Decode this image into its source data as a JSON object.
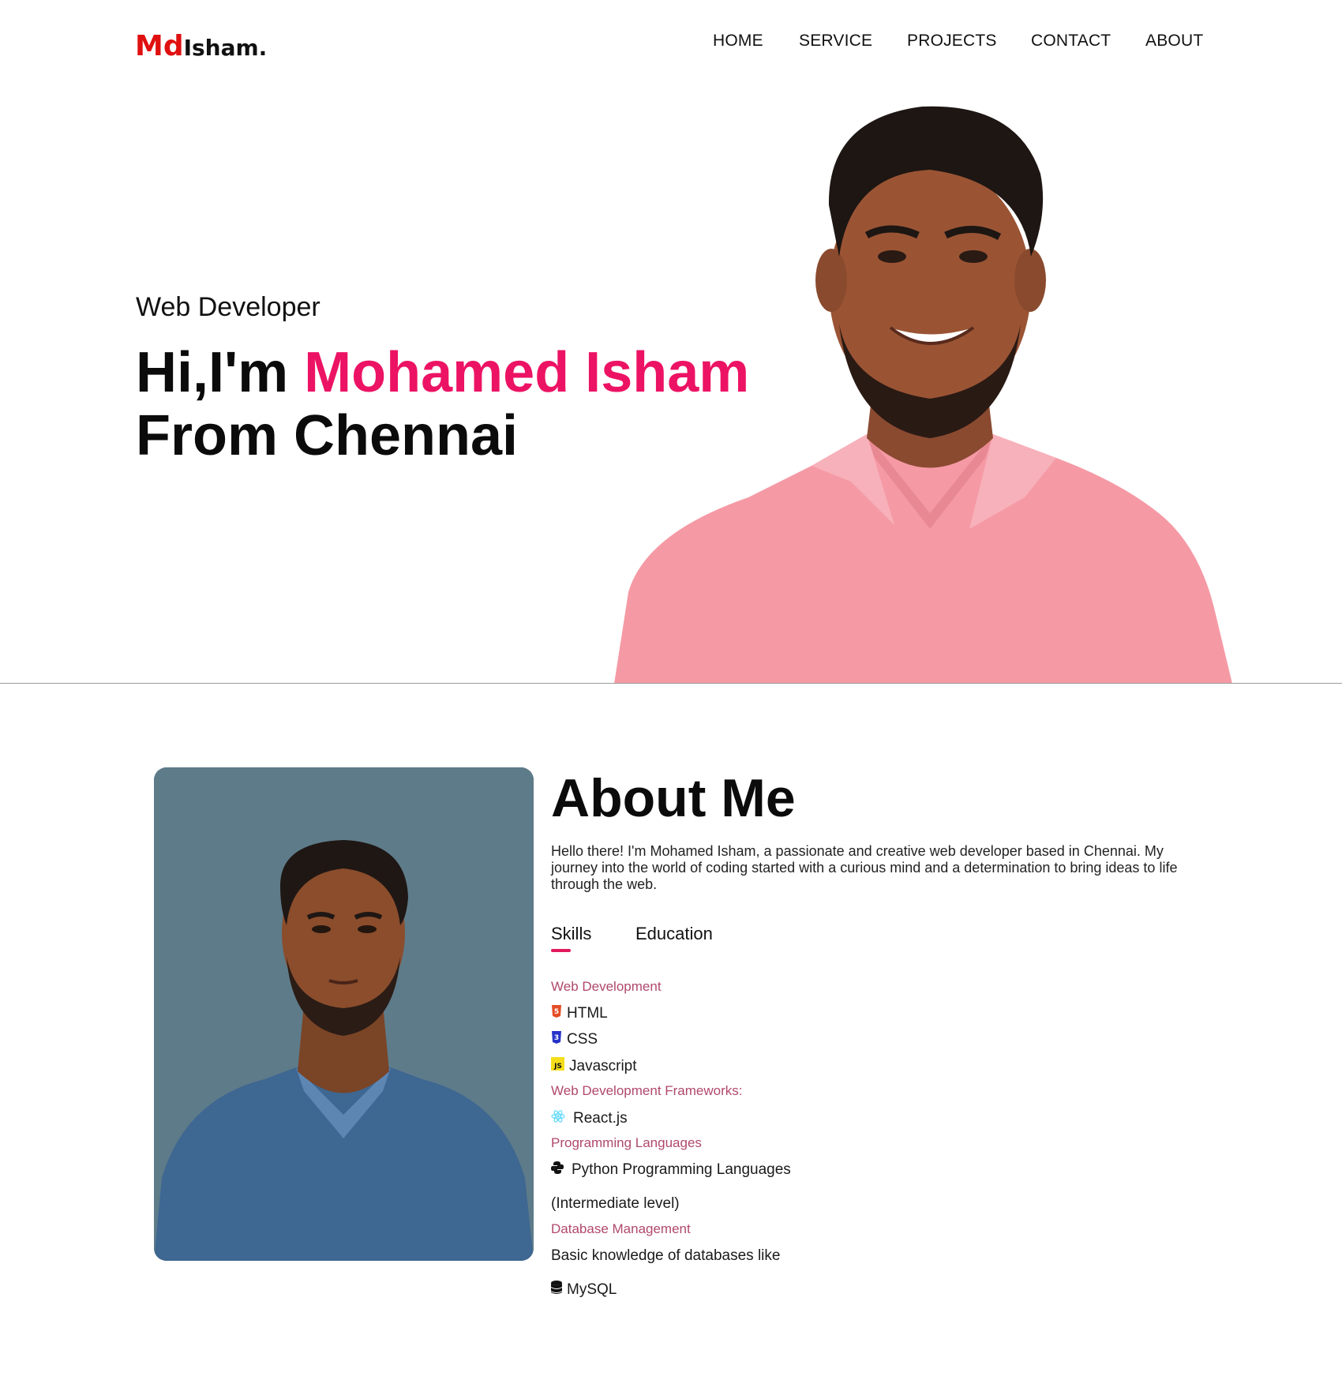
{
  "logo": {
    "md": "Md",
    "rest": "Isham."
  },
  "nav": {
    "home": "HOME",
    "service": "SERVICE",
    "projects": "PROJECTS",
    "contact": "CONTACT",
    "about": "ABOUT"
  },
  "hero": {
    "role": "Web Developer",
    "greeting": "Hi,I'm ",
    "name": "Mohamed Isham",
    "line2": "From Chennai"
  },
  "about": {
    "title": "About Me",
    "text": "Hello there! I'm Mohamed Isham, a passionate and creative web developer based in Chennai. My journey into the world of coding started with a curious mind and a determination to bring ideas to life through the web.",
    "tabs": {
      "skills": "Skills",
      "education": "Education"
    },
    "skills": {
      "web_dev_title": "Web Development",
      "html": "HTML",
      "css": "CSS",
      "js": "Javascript",
      "frameworks_title": "Web Development Frameworks:",
      "react": "React.js",
      "languages_title": "Programming Languages",
      "python": "Python Programming Languages",
      "python_level": "(Intermediate level)",
      "db_title": "Database Management",
      "db_text": "Basic knowledge of databases like",
      "mysql": "MySQL"
    }
  },
  "colors": {
    "accent": "#ec1364",
    "logo_red": "#e01010",
    "category": "#b0486d",
    "photo_bg": "#5e7b89"
  }
}
